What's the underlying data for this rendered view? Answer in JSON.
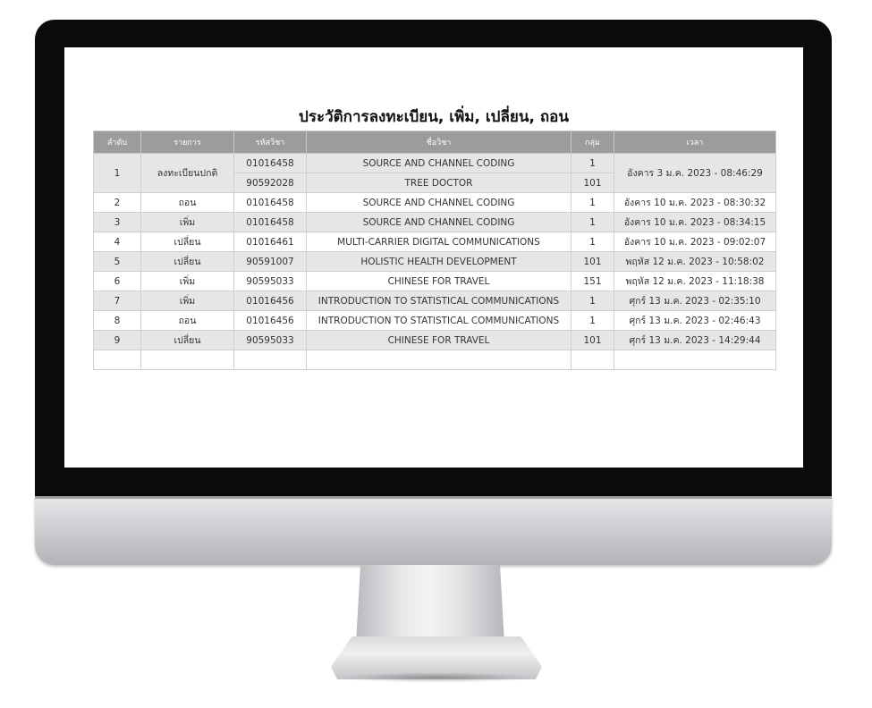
{
  "page": {
    "title": "ประวัติการลงทะเบียน, เพิ่ม, เปลี่ยน, ถอน"
  },
  "table": {
    "headers": [
      "ลำดับ",
      "รายการ",
      "รหัสวิชา",
      "ชื่อวิชา",
      "กลุ่ม",
      "เวลา"
    ],
    "rows": [
      {
        "no": "1",
        "action": "ลงทะเบียนปกติ",
        "time": "อังคาร 3 ม.ค. 2023 - 08:46:29",
        "courses": [
          {
            "code": "01016458",
            "name": "SOURCE AND CHANNEL CODING",
            "group": "1"
          },
          {
            "code": "90592028",
            "name": "TREE DOCTOR",
            "group": "101"
          }
        ]
      },
      {
        "no": "2",
        "action": "ถอน",
        "code": "01016458",
        "name": "SOURCE AND CHANNEL CODING",
        "group": "1",
        "time": "อังคาร 10 ม.ค. 2023 - 08:30:32"
      },
      {
        "no": "3",
        "action": "เพิ่ม",
        "code": "01016458",
        "name": "SOURCE AND CHANNEL CODING",
        "group": "1",
        "time": "อังคาร 10 ม.ค. 2023 - 08:34:15"
      },
      {
        "no": "4",
        "action": "เปลี่ยน",
        "code": "01016461",
        "name": "MULTI-CARRIER DIGITAL COMMUNICATIONS",
        "group": "1",
        "time": "อังคาร 10 ม.ค. 2023 - 09:02:07"
      },
      {
        "no": "5",
        "action": "เปลี่ยน",
        "code": "90591007",
        "name": "HOLISTIC HEALTH DEVELOPMENT",
        "group": "101",
        "time": "พฤหัส 12 ม.ค. 2023 - 10:58:02"
      },
      {
        "no": "6",
        "action": "เพิ่ม",
        "code": "90595033",
        "name": "CHINESE FOR TRAVEL",
        "group": "151",
        "time": "พฤหัส 12 ม.ค. 2023 - 11:18:38"
      },
      {
        "no": "7",
        "action": "เพิ่ม",
        "code": "01016456",
        "name": "INTRODUCTION TO STATISTICAL COMMUNICATIONS",
        "group": "1",
        "time": "ศุกร์ 13 ม.ค. 2023 - 02:35:10"
      },
      {
        "no": "8",
        "action": "ถอน",
        "code": "01016456",
        "name": "INTRODUCTION TO STATISTICAL COMMUNICATIONS",
        "group": "1",
        "time": "ศุกร์ 13 ม.ค. 2023 - 02:46:43"
      },
      {
        "no": "9",
        "action": "เปลี่ยน",
        "code": "90595033",
        "name": "CHINESE FOR TRAVEL",
        "group": "101",
        "time": "ศุกร์ 13 ม.ค. 2023 - 14:29:44"
      }
    ]
  },
  "colors": {
    "header_bg": "#9c9c9c",
    "row_shaded": "#e6e6e6",
    "row_plain": "#ffffff",
    "bezel": "#0b0b0b"
  }
}
